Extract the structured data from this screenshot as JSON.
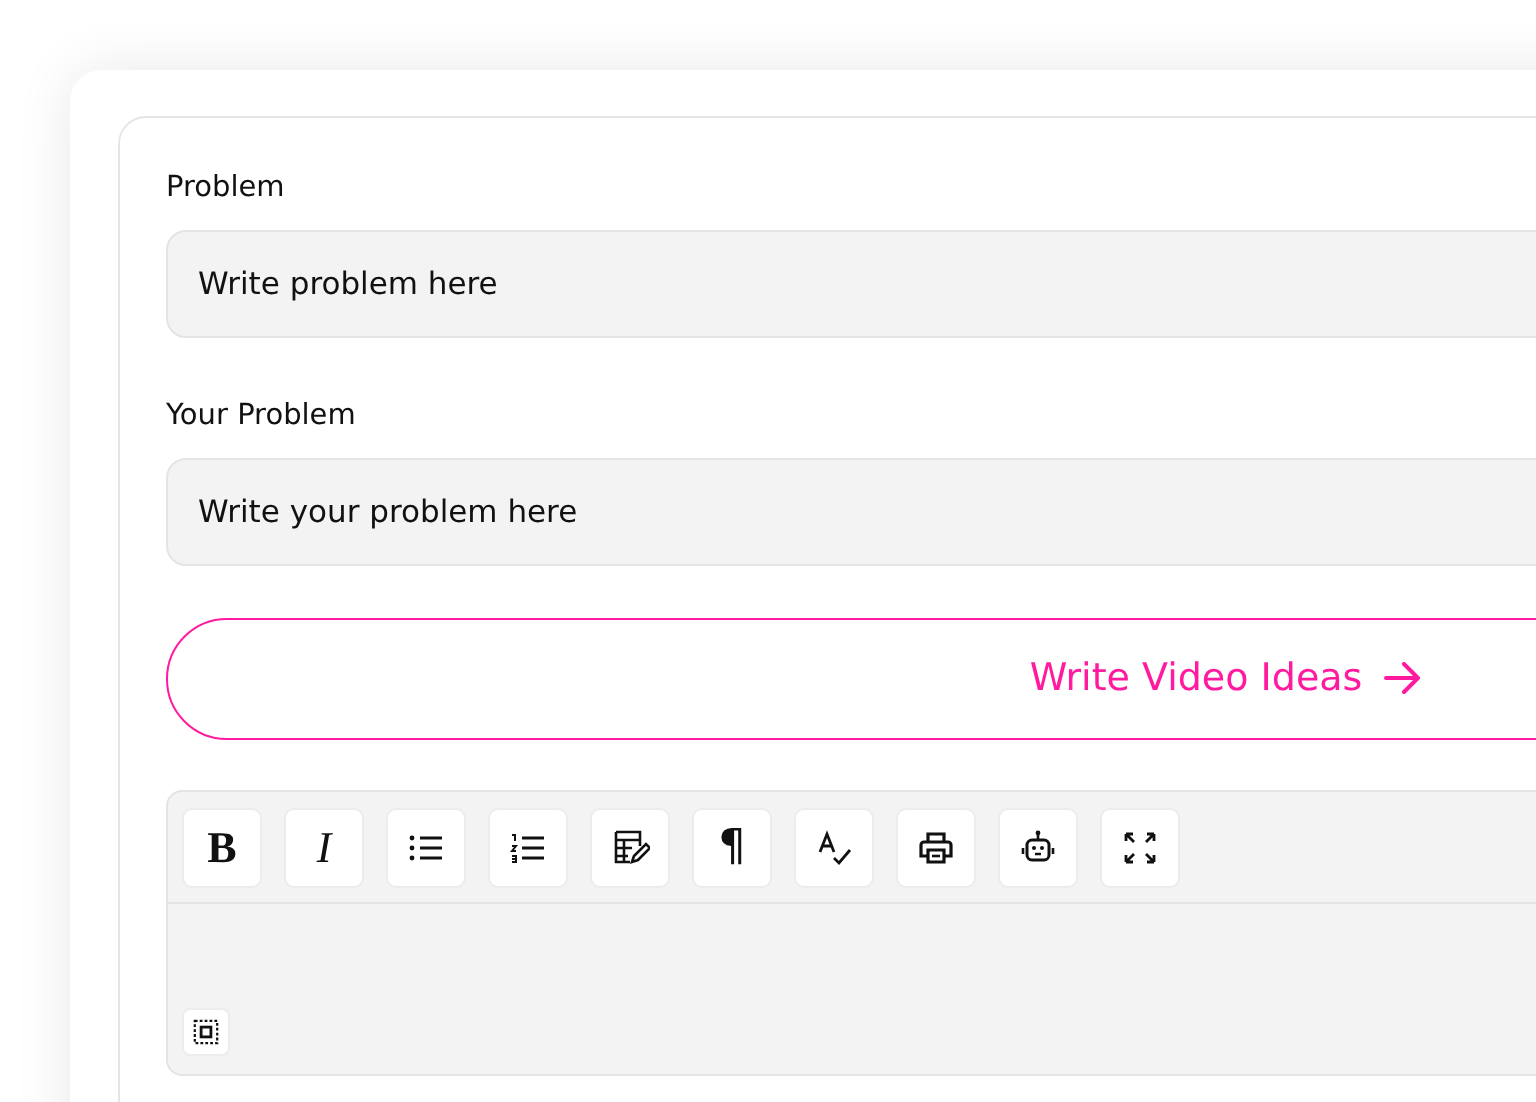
{
  "fields": [
    {
      "label": "Problem",
      "placeholder": "Write problem here"
    },
    {
      "label": "Your Problem",
      "placeholder": "Write your problem here"
    }
  ],
  "submit": {
    "label": "Write Video Ideas"
  },
  "toolbar": [
    {
      "kind": "bold",
      "label": "B"
    },
    {
      "kind": "italic",
      "label": "I"
    },
    {
      "kind": "bullets"
    },
    {
      "kind": "numbers"
    },
    {
      "kind": "edit-table"
    },
    {
      "kind": "paragraph",
      "label": "¶"
    },
    {
      "kind": "spellcheck"
    },
    {
      "kind": "print"
    },
    {
      "kind": "robot"
    },
    {
      "kind": "fullscreen"
    }
  ],
  "editor_footer": [
    {
      "kind": "select-all"
    }
  ]
}
